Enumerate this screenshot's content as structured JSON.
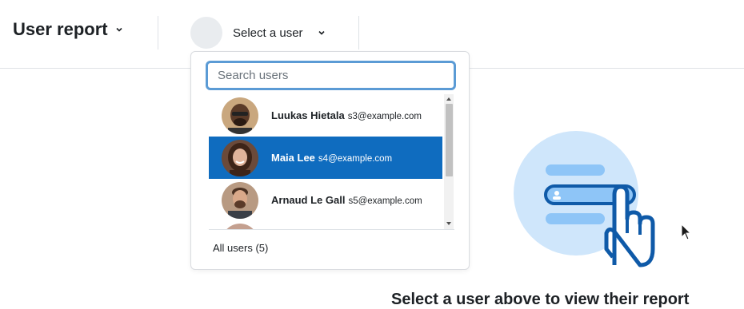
{
  "header": {
    "report_title": "User report",
    "user_selector": {
      "label": "Select a user"
    }
  },
  "dropdown": {
    "search_placeholder": "Search users",
    "users": [
      {
        "name": "Luukas Hietala",
        "email": "s3@example.com",
        "selected": false
      },
      {
        "name": "Maia Lee",
        "email": "s4@example.com",
        "selected": true
      },
      {
        "name": "Arnaud Le Gall",
        "email": "s5@example.com",
        "selected": false
      }
    ],
    "all_users_label": "All users (5)"
  },
  "main": {
    "cta_text": "Select a user above to view their report"
  },
  "colors": {
    "accent": "#0f6cbf",
    "focus_ring": "#5b9bd5",
    "illustration_bg": "#cfe6fb",
    "illustration_dark": "#0f5aa8"
  }
}
